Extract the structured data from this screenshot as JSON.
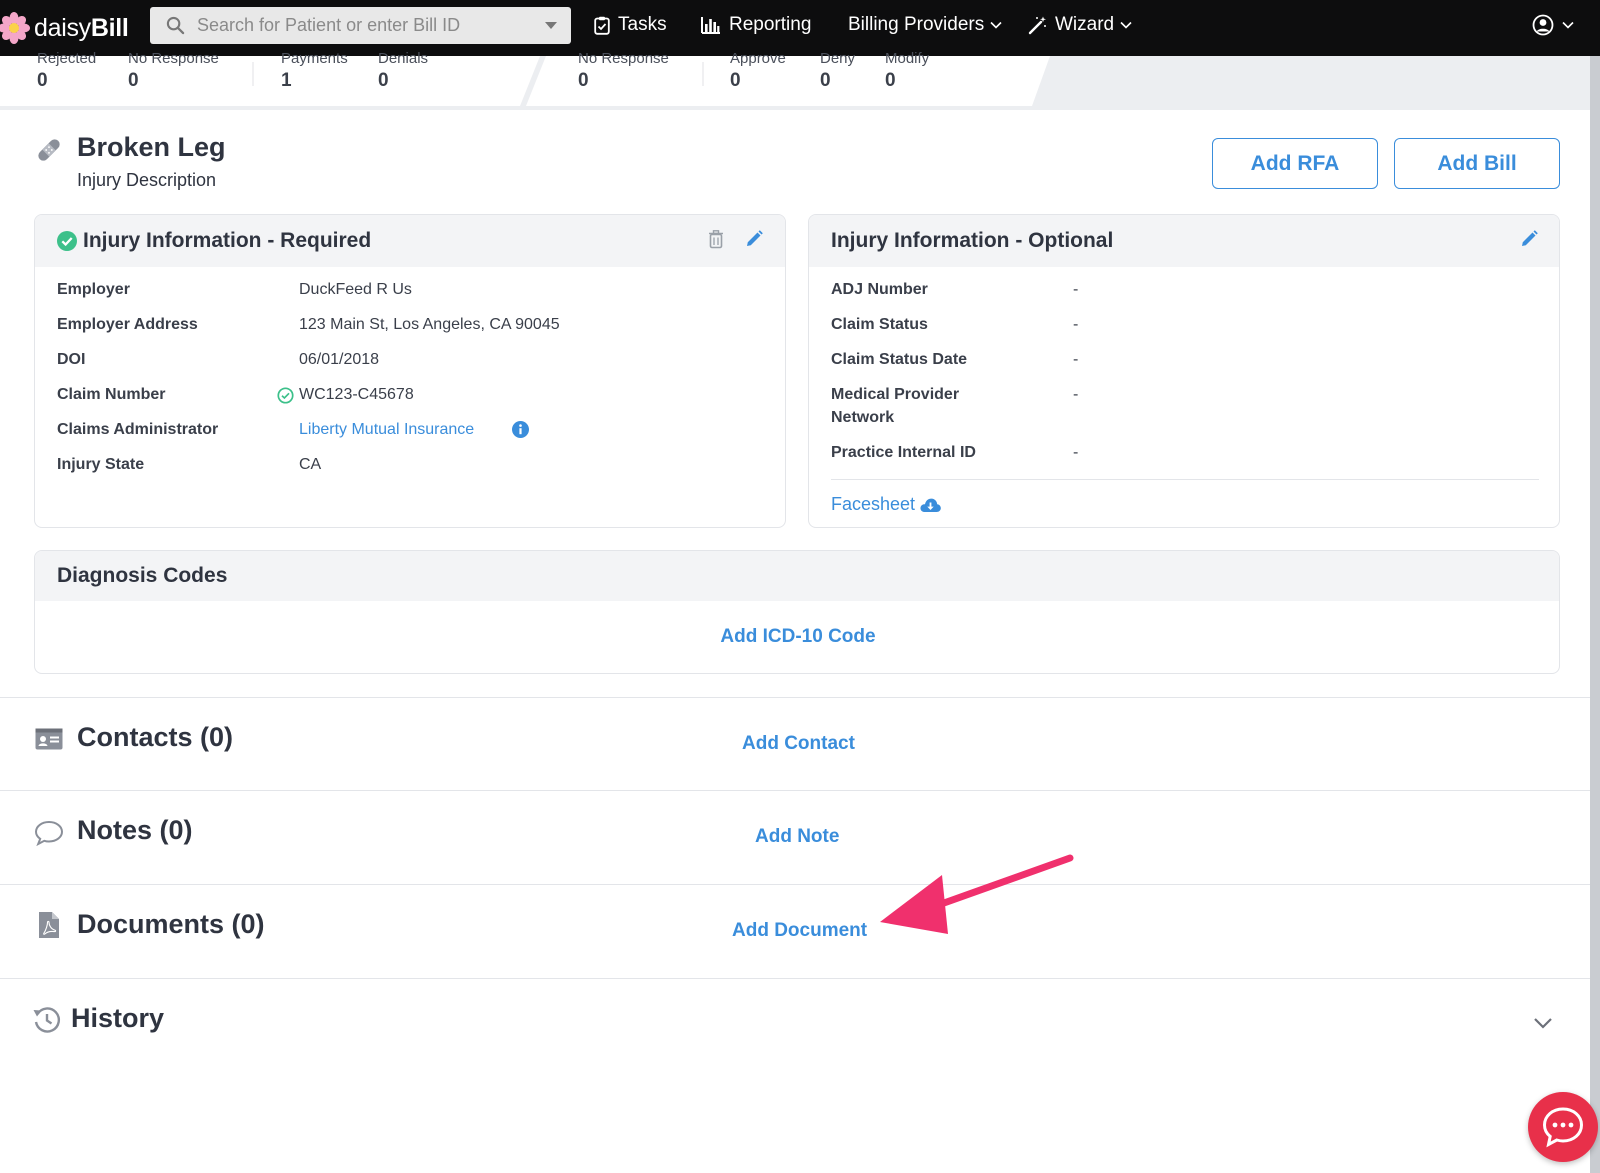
{
  "navbar": {
    "logo_text_light": "daisy",
    "logo_text_bold": "Bill",
    "search_placeholder": "Search for Patient or enter Bill ID",
    "items": [
      {
        "label": "Tasks",
        "icon": "clipboard-check-icon"
      },
      {
        "label": "Reporting",
        "icon": "bar-chart-icon"
      },
      {
        "label": "Billing Providers",
        "icon": "chevron-down-icon"
      },
      {
        "label": "Wizard",
        "icon": "magic-wand-icon"
      }
    ],
    "account_icon": "user-circle-icon"
  },
  "stats": {
    "group1": [
      {
        "label": "Rejected",
        "value": "0"
      },
      {
        "label": "No Response",
        "value": "0"
      },
      {
        "label": "Payments",
        "value": "1"
      },
      {
        "label": "Denials",
        "value": "0"
      }
    ],
    "group2": [
      {
        "label": "No Response",
        "value": "0"
      },
      {
        "label": "Approve",
        "value": "0"
      },
      {
        "label": "Deny",
        "value": "0"
      },
      {
        "label": "Modify",
        "value": "0"
      }
    ]
  },
  "injury": {
    "title": "Broken Leg",
    "subtitle": "Injury Description",
    "add_rfa": "Add RFA",
    "add_bill": "Add Bill"
  },
  "required_panel": {
    "title": "Injury Information - Required",
    "rows": [
      {
        "label": "Employer",
        "value": "DuckFeed R Us"
      },
      {
        "label": "Employer Address",
        "value": "123 Main St, Los Angeles, CA 90045"
      },
      {
        "label": "DOI",
        "value": "06/01/2018"
      },
      {
        "label": "Claim Number",
        "value": "WC123-C45678"
      },
      {
        "label": "Claims Administrator",
        "value": "Liberty Mutual Insurance"
      },
      {
        "label": "Injury State",
        "value": "CA"
      }
    ]
  },
  "optional_panel": {
    "title": "Injury Information - Optional",
    "rows": [
      {
        "label": "ADJ Number",
        "value": "-"
      },
      {
        "label": "Claim Status",
        "value": "-"
      },
      {
        "label": "Claim Status Date",
        "value": "-"
      },
      {
        "label": "Medical Provider",
        "label2": "Network",
        "value": "-"
      },
      {
        "label": "Practice Internal ID",
        "value": "-"
      }
    ],
    "facesheet": "Facesheet"
  },
  "diagnosis": {
    "title": "Diagnosis Codes",
    "add_link": "Add ICD-10 Code"
  },
  "sections": {
    "contacts": {
      "title": "Contacts (0)",
      "link": "Add Contact"
    },
    "notes": {
      "title": "Notes (0)",
      "link": "Add Note"
    },
    "documents": {
      "title": "Documents (0)",
      "link": "Add Document"
    },
    "history": {
      "title": "History"
    }
  },
  "colors": {
    "accent": "#3a8ddb",
    "success": "#3cc08a",
    "annotation_arrow": "#f0306d",
    "chat": "#e8304a"
  }
}
